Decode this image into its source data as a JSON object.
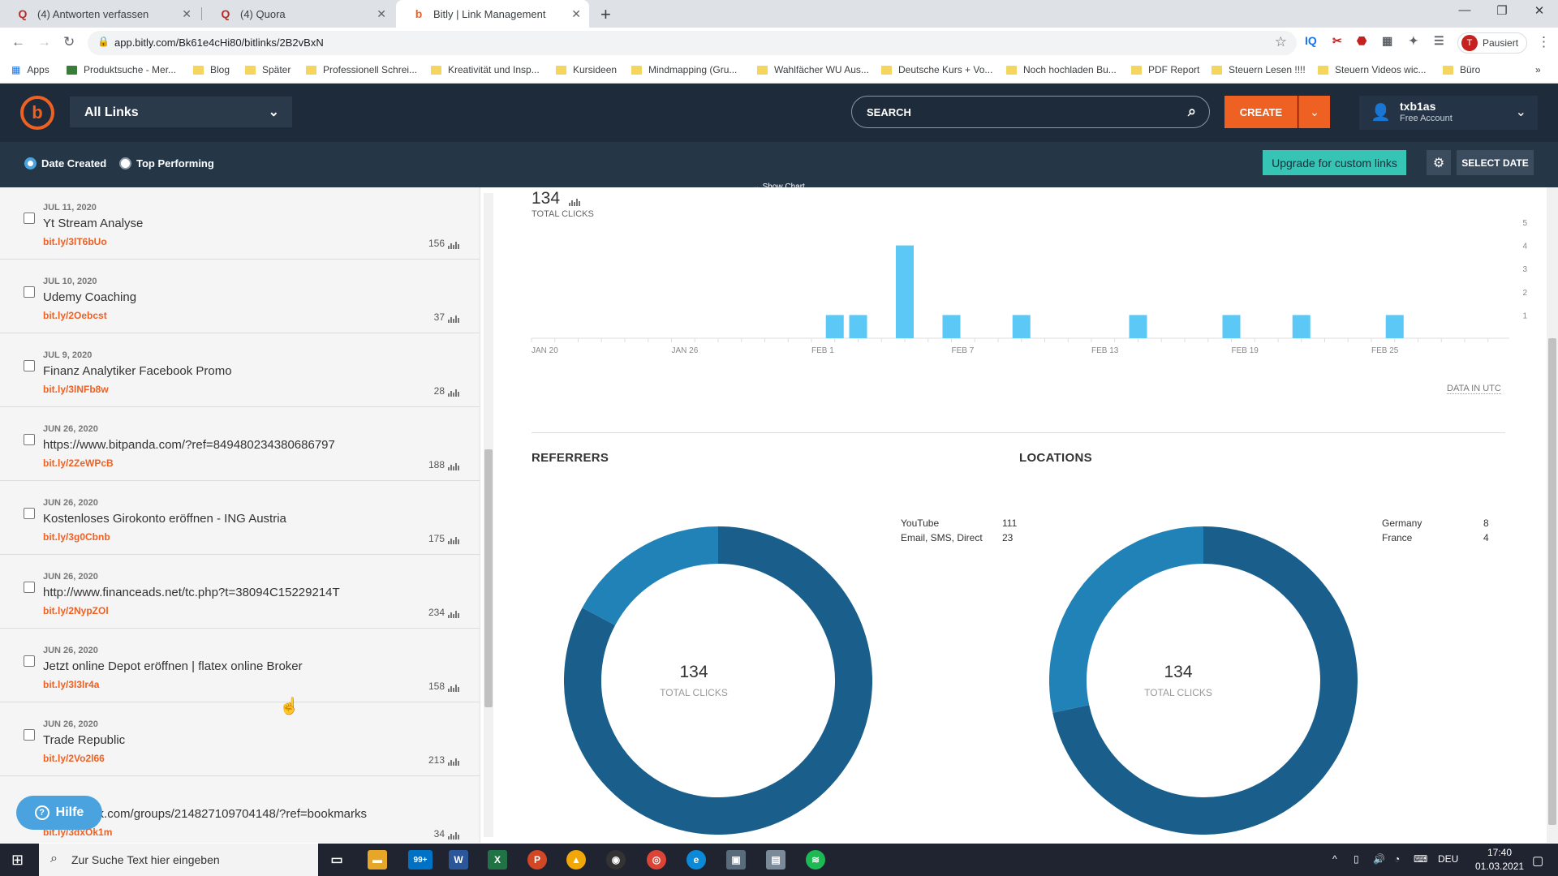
{
  "browser": {
    "tabs": [
      {
        "label": "(4) Antworten verfassen",
        "favicon": "Q"
      },
      {
        "label": "(4) Quora",
        "favicon": "Q"
      },
      {
        "label": "Bitly | Link Management",
        "favicon": "b"
      }
    ],
    "url": "app.bitly.com/Bk61e4cHi80/bitlinks/2B2vBxN",
    "profile_status": "Pausiert",
    "profile_initial": "T",
    "bookmarks": [
      "Apps",
      "Produktsuche - Mer...",
      "Blog",
      "Später",
      "Professionell Schrei...",
      "Kreativität und Insp...",
      "Kursideen",
      "Mindmapping (Gru...",
      "Wahlfächer WU Aus...",
      "Deutsche Kurs + Vo...",
      "Noch hochladen Bu...",
      "PDF Report",
      "Steuern Lesen !!!!",
      "Steuern Videos wic...",
      "Büro"
    ]
  },
  "header": {
    "dropdown_label": "All Links",
    "search_placeholder": "SEARCH",
    "create_label": "CREATE",
    "username": "txb1as",
    "plan": "Free Account"
  },
  "filters": {
    "date_created": "Date Created",
    "top_performing": "Top Performing",
    "upgrade_label": "Upgrade for custom links",
    "select_date_label": "SELECT DATE",
    "show_chart_label": "Show Chart"
  },
  "links": [
    {
      "date": "JUL 11, 2020",
      "title": "Yt Stream Analyse",
      "short": "bit.ly/3lT6bUo",
      "clicks": "156"
    },
    {
      "date": "JUL 10, 2020",
      "title": "Udemy Coaching",
      "short": "bit.ly/2Oebcst",
      "clicks": "37"
    },
    {
      "date": "JUL 9, 2020",
      "title": "Finanz Analytiker Facebook Promo",
      "short": "bit.ly/3lNFb8w",
      "clicks": "28"
    },
    {
      "date": "JUN 26, 2020",
      "title": "https://www.bitpanda.com/?ref=849480234380686797",
      "short": "bit.ly/2ZeWPcB",
      "clicks": "188"
    },
    {
      "date": "JUN 26, 2020",
      "title": "Kostenloses Girokonto eröffnen - ING Austria",
      "short": "bit.ly/3g0Cbnb",
      "clicks": "175"
    },
    {
      "date": "JUN 26, 2020",
      "title": "http://www.financeads.net/tc.php?t=38094C15229214T",
      "short": "bit.ly/2NypZOl",
      "clicks": "234"
    },
    {
      "date": "JUN 26, 2020",
      "title": "Jetzt online Depot eröffnen | flatex online Broker",
      "short": "bit.ly/3l3lr4a",
      "clicks": "158"
    },
    {
      "date": "JUN 26, 2020",
      "title": "Trade Republic",
      "short": "bit.ly/2Vo2l66",
      "clicks": "213"
    },
    {
      "date": "",
      "title": "w.facebook.com/groups/214827109704148/?ref=bookmarks",
      "short": "bit.ly/3dxOk1m",
      "clicks": "34"
    }
  ],
  "help_label": "Hilfe",
  "stats": {
    "total_clicks": "134",
    "total_clicks_label": "TOTAL CLICKS",
    "data_in_utc": "DATA IN UTC"
  },
  "chart_data": {
    "type": "bar",
    "x_tick_labels": [
      "JAN 20",
      "JAN 26",
      "FEB 1",
      "FEB 7",
      "FEB 13",
      "FEB 19",
      "FEB 25"
    ],
    "y_tick_labels": [
      "1",
      "2",
      "3",
      "4",
      "5"
    ],
    "ylim": [
      0,
      5
    ],
    "bar_color": "#5bc8f5",
    "x": [
      "FEB 2",
      "FEB 3",
      "FEB 5",
      "FEB 7",
      "FEB 10",
      "FEB 15",
      "FEB 19",
      "FEB 22",
      "FEB 26"
    ],
    "values": [
      1,
      1,
      4,
      1,
      1,
      1,
      1,
      1,
      1
    ]
  },
  "referrers": {
    "title": "REFERRERS",
    "items": [
      {
        "name": "YouTube",
        "value": "111"
      },
      {
        "name": "Email, SMS, Direct",
        "value": "23"
      }
    ],
    "colors": [
      "#1a5e8c",
      "#2182b8"
    ]
  },
  "locations": {
    "title": "LOCATIONS",
    "items": [
      {
        "name": "Germany",
        "value": "8"
      },
      {
        "name": "France",
        "value": "4"
      }
    ],
    "slices": [
      96,
      38
    ],
    "colors": [
      "#1a5e8c",
      "#2182b8"
    ]
  },
  "taskbar": {
    "search_placeholder": "Zur Suche Text hier eingeben",
    "lang": "DEU",
    "time": "17:40",
    "date": "01.03.2021",
    "mail_badge": "99+"
  }
}
